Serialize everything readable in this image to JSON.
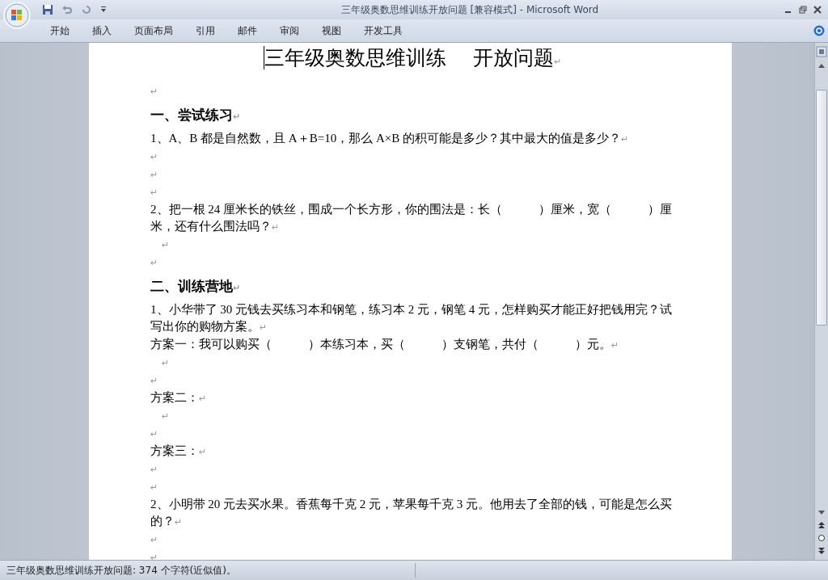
{
  "window": {
    "title": "三年级奥数思维训练开放问题 [兼容模式] - Microsoft Word"
  },
  "tabs": [
    {
      "label": "开始",
      "selected": false
    },
    {
      "label": "插入",
      "selected": false
    },
    {
      "label": "页面布局",
      "selected": false
    },
    {
      "label": "引用",
      "selected": false
    },
    {
      "label": "邮件",
      "selected": false
    },
    {
      "label": "审阅",
      "selected": false
    },
    {
      "label": "视图",
      "selected": false
    },
    {
      "label": "开发工具",
      "selected": false
    }
  ],
  "document": {
    "paragraphs": [
      {
        "kind": "title",
        "text": "三年级奥数思维训练　 开放问题",
        "mark": "↵"
      },
      {
        "kind": "blank",
        "mark": "↵"
      },
      {
        "kind": "heading",
        "text": "一、尝试练习",
        "mark": "↵"
      },
      {
        "kind": "body",
        "text": "1、A、B 都是自然数，且 A＋B=10，那么 A×B 的积可能是多少？其中最大的值是多少？",
        "mark": "↵"
      },
      {
        "kind": "blank",
        "mark": "↵"
      },
      {
        "kind": "blank",
        "mark": "↵"
      },
      {
        "kind": "blank",
        "mark": "↵"
      },
      {
        "kind": "body",
        "text": "2、把一根 24 厘米长的铁丝，围成一个长方形，你的围法是：长（　　　）厘米，宽（　　　）厘米，还有什么围法吗？",
        "mark": "↵"
      },
      {
        "kind": "indented",
        "mark": "↵"
      },
      {
        "kind": "blank",
        "mark": "↵"
      },
      {
        "kind": "heading",
        "text": "二、训练营地",
        "mark": "↵"
      },
      {
        "kind": "body",
        "text": "1、小华带了 30 元钱去买练习本和钢笔，练习本 2 元，钢笔 4 元，怎样购买才能正好把钱用完？试写出你的购物方案。",
        "mark": "↵"
      },
      {
        "kind": "body",
        "text": "方案一：我可以购买（　　　）本练习本，买（　　　）支钢笔，共付（　　　）元。",
        "mark": "↵"
      },
      {
        "kind": "indented",
        "mark": "↵"
      },
      {
        "kind": "blank",
        "mark": "↵"
      },
      {
        "kind": "body",
        "text": "方案二：",
        "mark": "↵"
      },
      {
        "kind": "indented",
        "mark": "↵"
      },
      {
        "kind": "blank",
        "mark": "↵"
      },
      {
        "kind": "body",
        "text": "方案三：",
        "mark": "↵"
      },
      {
        "kind": "blank",
        "mark": "↵"
      },
      {
        "kind": "blank",
        "mark": "↵"
      },
      {
        "kind": "body",
        "text": "2、小明带 20 元去买水果。香蕉每千克 2 元，苹果每千克 3 元。他用去了全部的钱，可能是怎么买的？",
        "mark": "↵"
      },
      {
        "kind": "blank",
        "mark": "↵"
      },
      {
        "kind": "blank",
        "mark": "↵"
      }
    ]
  },
  "status_bar": {
    "text": "三年级奥数思维训练开放问题: 374 个字符(近似值)。"
  }
}
